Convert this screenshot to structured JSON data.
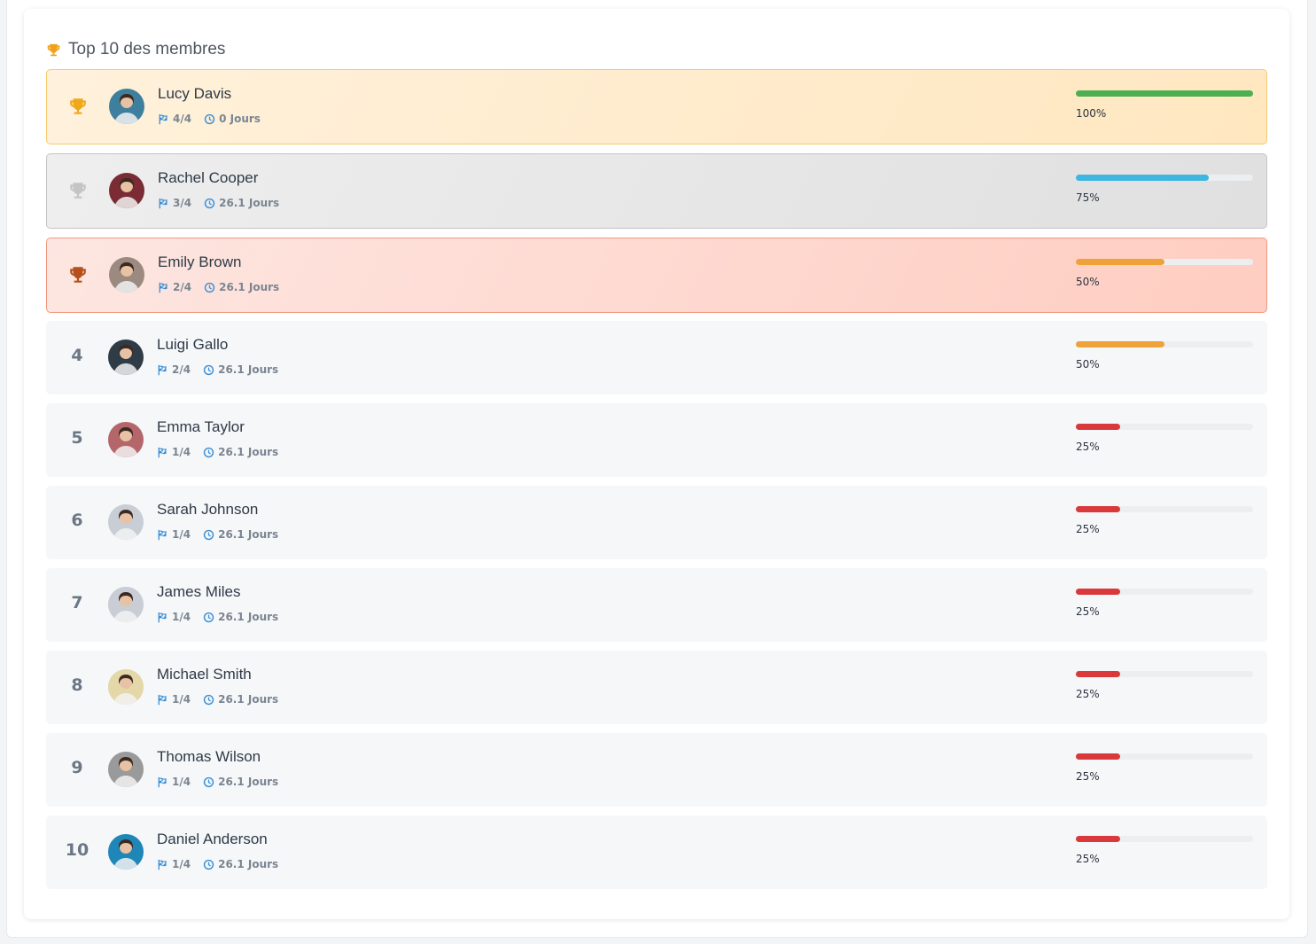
{
  "heading": {
    "title": "Top 10 des membres",
    "icon": "trophy-icon",
    "icon_color": "#f0a11a"
  },
  "colors": {
    "gold_trophy": "#f0a81a",
    "silver_trophy": "#c4c4c4",
    "bronze_trophy": "#b4501c",
    "flag_icon": "#3a8fd6",
    "clock_icon": "#3a8fd6"
  },
  "members": [
    {
      "rank": "1",
      "medal": "gold",
      "name": "Lucy Davis",
      "challenges": "4/4",
      "time": "0 Jours",
      "progress": 100,
      "progress_label": "100%",
      "bar_color": "#4caf50",
      "avatar": "avatar-icon",
      "avatar_bg": "#3f7f9e"
    },
    {
      "rank": "2",
      "medal": "silver",
      "name": "Rachel Cooper",
      "challenges": "3/4",
      "time": "26.1 Jours",
      "progress": 75,
      "progress_label": "75%",
      "bar_color": "#3fb6e0",
      "avatar": "avatar-icon",
      "avatar_bg": "#7a2b34"
    },
    {
      "rank": "3",
      "medal": "bronze",
      "name": "Emily Brown",
      "challenges": "2/4",
      "time": "26.1 Jours",
      "progress": 50,
      "progress_label": "50%",
      "bar_color": "#f0a23a",
      "avatar": "avatar-icon",
      "avatar_bg": "#9c8a80"
    },
    {
      "rank": "4",
      "name": "Luigi Gallo",
      "challenges": "2/4",
      "time": "26.1 Jours",
      "progress": 50,
      "progress_label": "50%",
      "bar_color": "#f0a23a",
      "avatar": "avatar-icon",
      "avatar_bg": "#2f3b45"
    },
    {
      "rank": "5",
      "name": "Emma Taylor",
      "challenges": "1/4",
      "time": "26.1 Jours",
      "progress": 25,
      "progress_label": "25%",
      "bar_color": "#d9393b",
      "avatar": "avatar-icon",
      "avatar_bg": "#b5666b"
    },
    {
      "rank": "6",
      "name": "Sarah Johnson",
      "challenges": "1/4",
      "time": "26.1 Jours",
      "progress": 25,
      "progress_label": "25%",
      "bar_color": "#d9393b",
      "avatar": "avatar-icon",
      "avatar_bg": "#c9ced6"
    },
    {
      "rank": "7",
      "name": "James Miles",
      "challenges": "1/4",
      "time": "26.1 Jours",
      "progress": 25,
      "progress_label": "25%",
      "bar_color": "#d9393b",
      "avatar": "avatar-icon",
      "avatar_bg": "#c9ced6"
    },
    {
      "rank": "8",
      "name": "Michael Smith",
      "challenges": "1/4",
      "time": "26.1 Jours",
      "progress": 25,
      "progress_label": "25%",
      "bar_color": "#d9393b",
      "avatar": "avatar-icon",
      "avatar_bg": "#e4d8a8"
    },
    {
      "rank": "9",
      "name": "Thomas Wilson",
      "challenges": "1/4",
      "time": "26.1 Jours",
      "progress": 25,
      "progress_label": "25%",
      "bar_color": "#d9393b",
      "avatar": "avatar-icon",
      "avatar_bg": "#9a9a9a"
    },
    {
      "rank": "10",
      "name": "Daniel Anderson",
      "challenges": "1/4",
      "time": "26.1 Jours",
      "progress": 25,
      "progress_label": "25%",
      "bar_color": "#d9393b",
      "avatar": "avatar-icon",
      "avatar_bg": "#1f86b8"
    }
  ]
}
